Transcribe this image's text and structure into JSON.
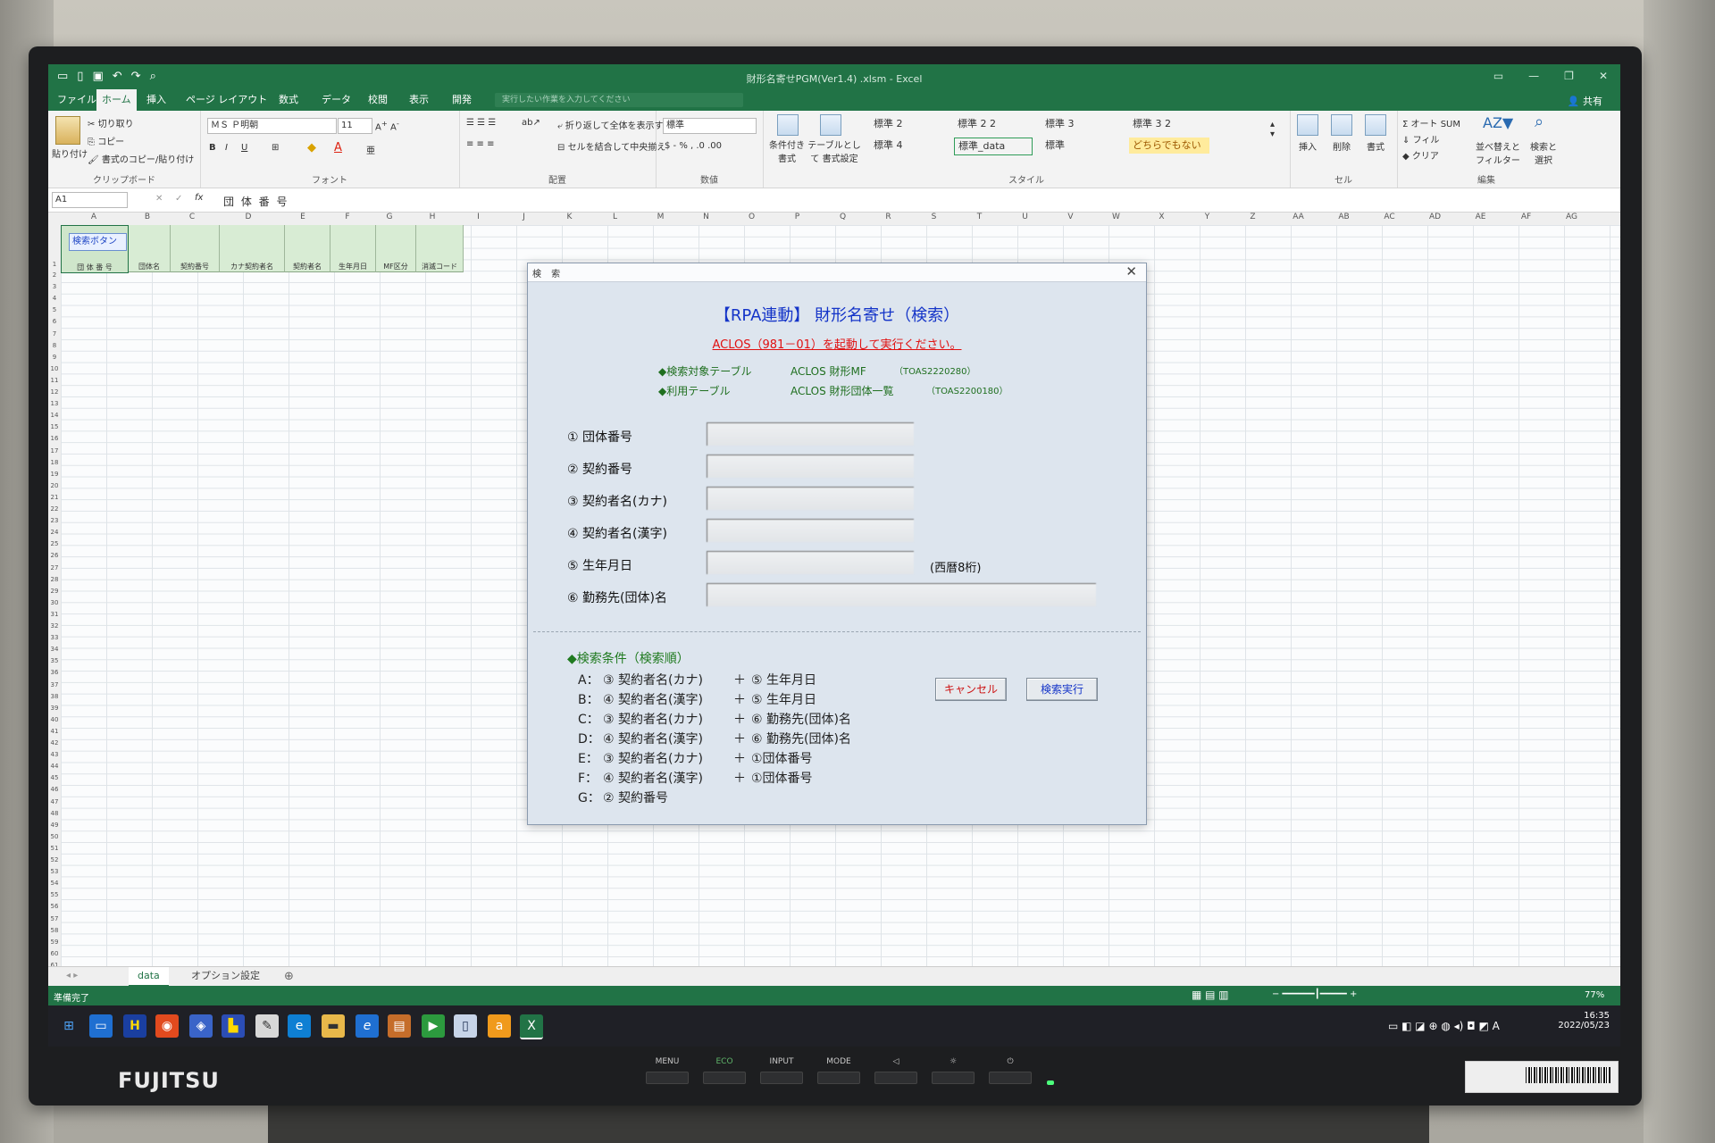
{
  "excel": {
    "window_title": "財形名寄せPGM(Ver1.4) .xlsm - Excel",
    "tabs": [
      "ファイル",
      "ホーム",
      "挿入",
      "ページ レイアウト",
      "数式",
      "データ",
      "校閲",
      "表示",
      "開発"
    ],
    "tell_me_placeholder": "実行したい作業を入力してください",
    "share": "共有",
    "ribbon": {
      "clipboard": {
        "paste": "貼り付け",
        "cut": "切り取り",
        "copy": "コピー",
        "format_painter": "書式のコピー/貼り付け",
        "label": "クリップボード"
      },
      "font": {
        "name": "ＭＳ Ｐ明朝",
        "size": "11",
        "label": "フォント"
      },
      "alignment": {
        "wrap": "折り返して全体を表示する",
        "merge": "セルを結合して中央揃え",
        "label": "配置"
      },
      "number": {
        "format": "標準",
        "label": "数値"
      },
      "styles": {
        "cond_format": "条件付き 書式",
        "as_table": "テーブルとして 書式設定",
        "cells": [
          "標準 2",
          "標準 2 2",
          "標準 3",
          "標準 3 2",
          "標準 4",
          "標準_data",
          "標準",
          "どちらでもない"
        ],
        "label": "スタイル"
      },
      "cells": {
        "insert": "挿入",
        "delete": "削除",
        "format": "書式",
        "label": "セル"
      },
      "editing": {
        "autosum": "オート SUM",
        "fill": "フィル",
        "clear": "クリア",
        "sort": "並べ替えと フィルター",
        "find": "検索と 選択",
        "label": "編集"
      }
    },
    "name_box": "A1",
    "formula": "団 体 番 号",
    "columns": [
      "A",
      "B",
      "C",
      "D",
      "E",
      "F",
      "G",
      "H",
      "I",
      "J",
      "K",
      "L",
      "M",
      "N",
      "O",
      "P",
      "Q",
      "R",
      "S",
      "T",
      "U",
      "V",
      "W",
      "X",
      "Y",
      "Z",
      "AA",
      "AB",
      "AC",
      "AD",
      "AE",
      "AF",
      "AG"
    ],
    "header_cells": [
      "団 体 番 号",
      "団体名",
      "契約番号",
      "カナ契約者名",
      "契約者名",
      "生年月日",
      "MF区分",
      "消滅コード"
    ],
    "sheet_button": "検索ボタン",
    "sheet_tabs": [
      "data",
      "オプション設定"
    ],
    "status": "準備完了",
    "zoom": "77%"
  },
  "dialog": {
    "title": "検 索",
    "heading": "【RPA連動】 財形名寄せ（検索）",
    "warning": "ACLOS（981－01）を起動して実行ください。",
    "info": [
      {
        "label": "◆検索対象テーブル",
        "table": "ACLOS 財形MF",
        "code": "（TOAS2220280）"
      },
      {
        "label": "◆利用テーブル",
        "table": "ACLOS 財形団体一覧",
        "code": "（TOAS2200180）"
      }
    ],
    "fields": [
      {
        "label": "① 団体番号"
      },
      {
        "label": "② 契約番号"
      },
      {
        "label": "③ 契約者名(カナ)"
      },
      {
        "label": "④ 契約者名(漢字)"
      },
      {
        "label": "⑤ 生年月日",
        "note": "(西暦8桁)"
      },
      {
        "label": "⑥ 勤務先(団体)名"
      }
    ],
    "conditions_heading": "◆検索条件（検索順）",
    "conditions": [
      {
        "key": "A：",
        "a": "③ 契約者名(カナ)",
        "plus": "＋",
        "b": "⑤ 生年月日"
      },
      {
        "key": "B：",
        "a": "④ 契約者名(漢字)",
        "plus": "＋",
        "b": "⑤ 生年月日"
      },
      {
        "key": "C：",
        "a": "③ 契約者名(カナ)",
        "plus": "＋",
        "b": "⑥ 勤務先(団体)名"
      },
      {
        "key": "D：",
        "a": "④ 契約者名(漢字)",
        "plus": "＋",
        "b": "⑥ 勤務先(団体)名"
      },
      {
        "key": "E：",
        "a": "③ 契約者名(カナ)",
        "plus": "＋",
        "b": "①団体番号"
      },
      {
        "key": "F：",
        "a": "④ 契約者名(漢字)",
        "plus": "＋",
        "b": "①団体番号"
      },
      {
        "key": "G：",
        "a": "② 契約番号",
        "plus": "",
        "b": ""
      }
    ],
    "cancel": "キャンセル",
    "execute": "検索実行"
  },
  "taskbar": {
    "time": "16:35",
    "date": "2022/05/23"
  },
  "monitor": {
    "brand": "FUJITSU",
    "buttons": [
      "MENU",
      "ECO",
      "INPUT",
      "MODE",
      "◁",
      "☼",
      "⏻"
    ]
  },
  "colors": {
    "excel_green": "#217346",
    "dialog_bg": "#dde5ee",
    "heading_blue": "#1434c8",
    "warn_red": "#e01111",
    "info_green": "#1f6f1f"
  }
}
